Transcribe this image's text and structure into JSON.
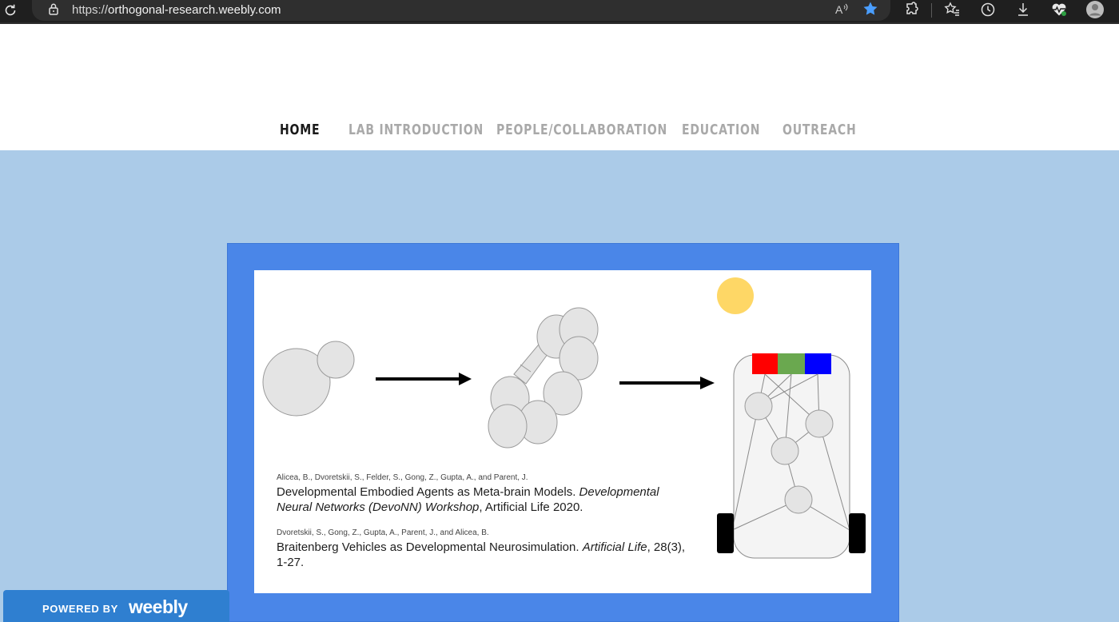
{
  "browser": {
    "url_scheme": "https://",
    "url_host": "orthogonal-research.weebly.com",
    "icons": [
      "refresh-icon",
      "lock-icon",
      "read-aloud-icon",
      "favorite-star-icon",
      "extensions-icon",
      "favorites-icon",
      "history-icon",
      "download-icon",
      "health-icon",
      "profile-icon"
    ],
    "accent_color": "#4a9eff"
  },
  "nav": {
    "items": [
      {
        "label": "HOME",
        "active": true
      },
      {
        "label": "LAB INTRODUCTION",
        "active": false
      },
      {
        "label": "PEOPLE/COLLABORATION",
        "active": false
      },
      {
        "label": "EDUCATION",
        "active": false
      },
      {
        "label": "OUTREACH",
        "active": false
      }
    ]
  },
  "colors": {
    "hero_background": "#abcbe8",
    "frame_blue": "#4a86e8",
    "sun": "#fed766",
    "sensor_red": "#ff0000",
    "sensor_green": "#6aa84f",
    "sensor_blue": "#0000ff",
    "weebly_blue": "#2f7fd0"
  },
  "citations": [
    {
      "authors": "Alicea, B., Dvoretskii, S., Felder, S., Gong, Z., Gupta, A., and Parent, J.",
      "title": "Developmental Embodied Agents as Meta-brain Models. ",
      "venue_italic": "Developmental Neural Networks (DevoNN) Workshop",
      "venue_rest": ", Artificial Life 2020."
    },
    {
      "authors": "Dvoretskii, S., Gong, Z., Gupta, A., Parent, J., and Alicea, B.",
      "title": "Braitenberg Vehicles as Developmental Neurosimulation. ",
      "venue_italic": "Artificial Life",
      "venue_rest": ", 28(3), 1-27."
    }
  ],
  "badge": {
    "powered_by": "POWERED BY",
    "logo": "weebly"
  }
}
